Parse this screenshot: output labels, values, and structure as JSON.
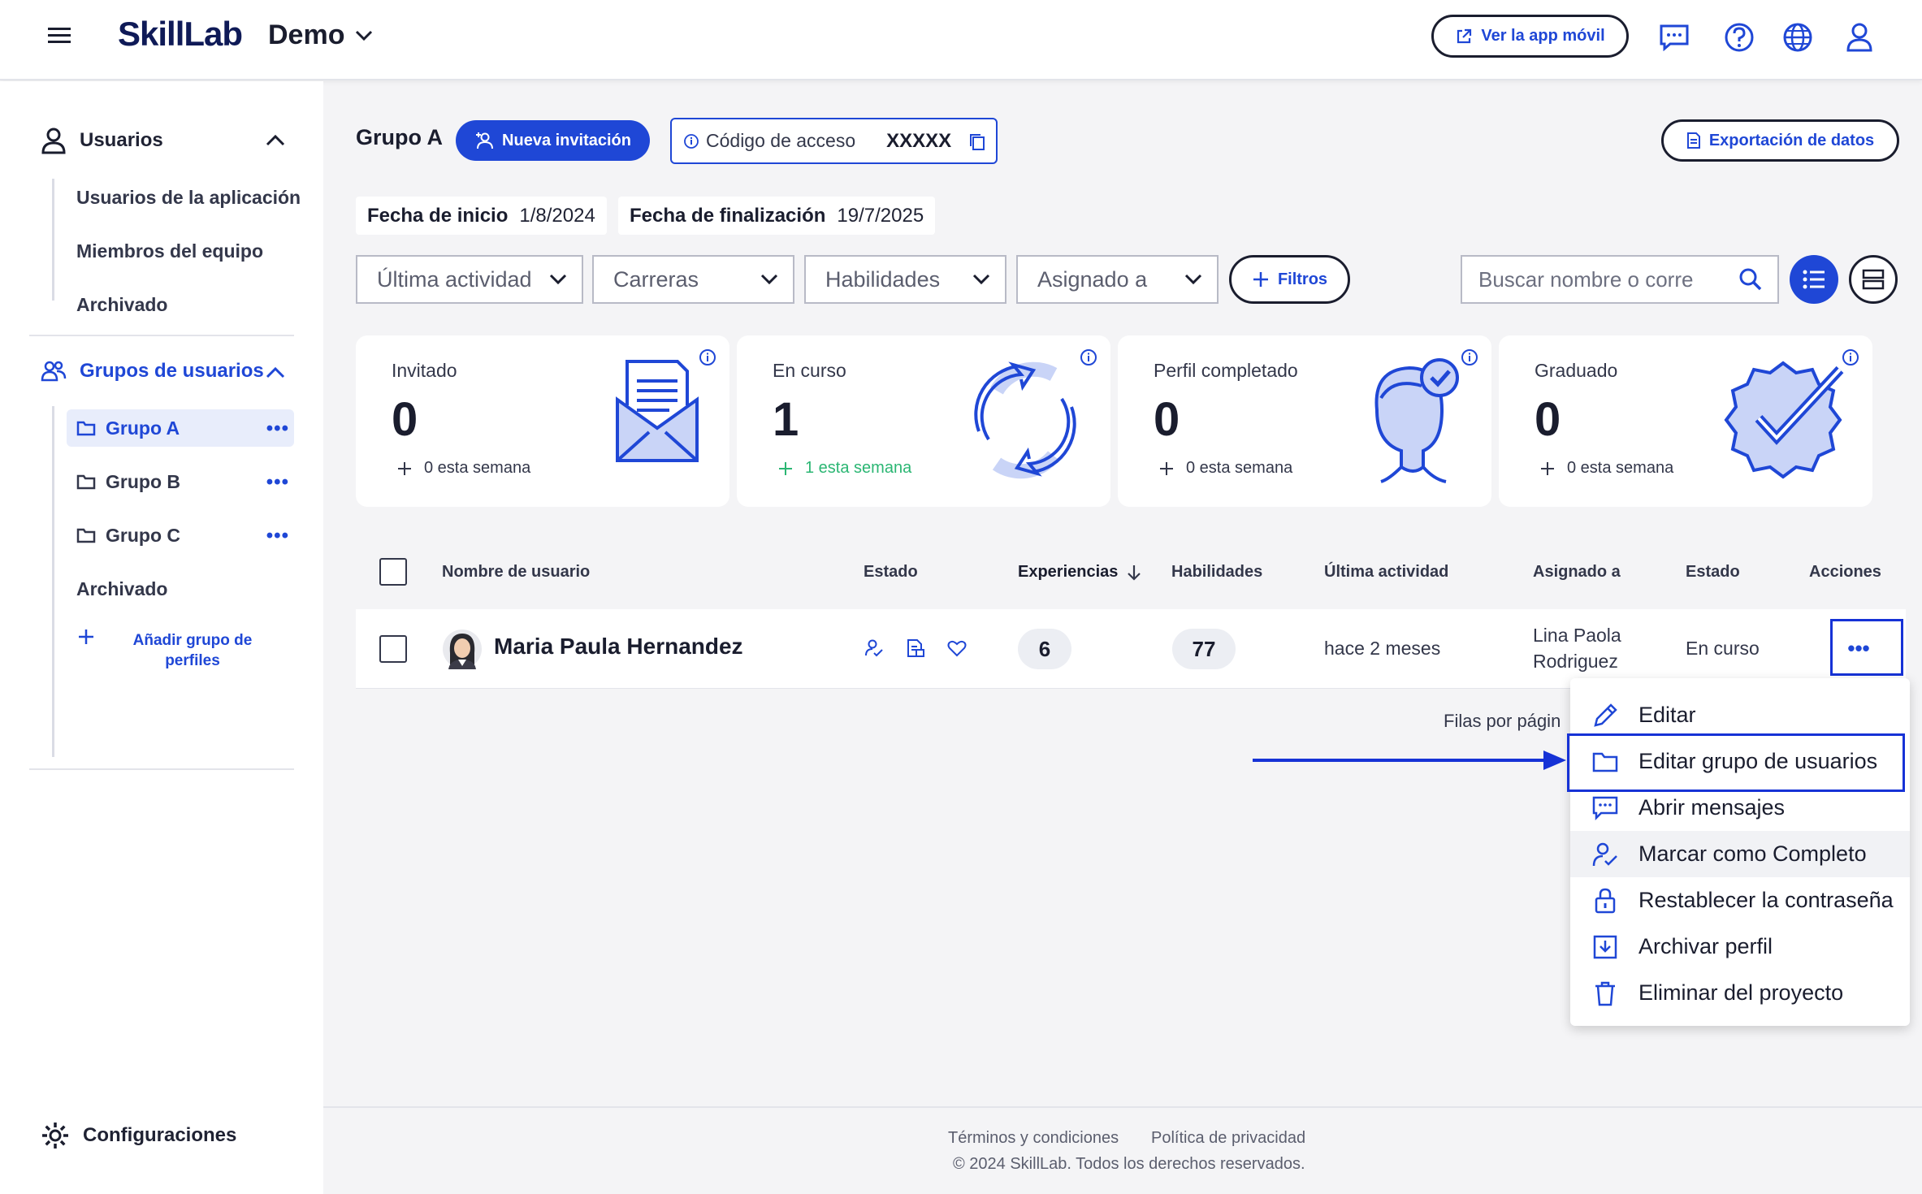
{
  "header": {
    "brand": "SkillLab",
    "project": "Demo",
    "mobile_app_label": "Ver la app móvil"
  },
  "sidebar": {
    "users_section": "Usuarios",
    "users_items": [
      "Usuarios de la aplicación",
      "Miembros del equipo",
      "Archivado"
    ],
    "groups_section": "Grupos de usuarios",
    "groups": [
      {
        "label": "Grupo A",
        "active": true
      },
      {
        "label": "Grupo B",
        "active": false
      },
      {
        "label": "Grupo C",
        "active": false
      }
    ],
    "groups_archived": "Archivado",
    "add_group_line1": "Añadir grupo de",
    "add_group_line2": "perfiles",
    "settings": "Configuraciones"
  },
  "main": {
    "group_title": "Grupo A",
    "new_invite": "Nueva invitación",
    "access_code_label": "Código de acceso",
    "access_code_value": "XXXXX",
    "export_label": "Exportación de datos",
    "start_label": "Fecha de inicio",
    "start_value": "1/8/2024",
    "end_label": "Fecha de finalización",
    "end_value": "19/7/2025",
    "filters": [
      "Última actividad",
      "Carreras",
      "Habilidades",
      "Asignado a"
    ],
    "filters_button": "Filtros",
    "search_placeholder": "Buscar nombre o corre"
  },
  "stats": [
    {
      "label": "Invitado",
      "value": "0",
      "week": "0 esta semana"
    },
    {
      "label": "En curso",
      "value": "1",
      "week": "1 esta semana"
    },
    {
      "label": "Perfil completado",
      "value": "0",
      "week": "0 esta semana"
    },
    {
      "label": "Graduado",
      "value": "0",
      "week": "0 esta semana"
    }
  ],
  "table": {
    "headers": {
      "username": "Nombre de usuario",
      "status": "Estado",
      "experiences": "Experiencias",
      "skills": "Habilidades",
      "last_activity": "Última actividad",
      "assigned": "Asignado a",
      "state": "Estado",
      "actions": "Acciones"
    },
    "rows": [
      {
        "name": "Maria Paula Hernandez",
        "experiences": "6",
        "skills": "77",
        "last_activity": "hace 2 meses",
        "assigned_line1": "Lina Paola",
        "assigned_line2": "Rodriguez",
        "state": "En curso"
      }
    ],
    "rows_per_page": "Filas por págin"
  },
  "menu": {
    "items": [
      {
        "label": "Editar",
        "icon": "pencil-icon"
      },
      {
        "label": "Editar grupo de usuarios",
        "icon": "folder-icon"
      },
      {
        "label": "Abrir mensajes",
        "icon": "message-icon"
      },
      {
        "label": "Marcar como Completo",
        "icon": "user-check-icon"
      },
      {
        "label": "Restablecer la contraseña",
        "icon": "lock-icon"
      },
      {
        "label": "Archivar perfil",
        "icon": "archive-icon"
      },
      {
        "label": "Eliminar del proyecto",
        "icon": "trash-icon"
      }
    ]
  },
  "footer": {
    "terms": "Términos y condiciones",
    "privacy": "Política de privacidad",
    "copyright": "© 2024 SkillLab. Todos los derechos reservados."
  },
  "colors": {
    "accent": "#1f47d6",
    "annotation": "#1632d6",
    "text": "#1a1d2e",
    "green": "#2bb673"
  }
}
